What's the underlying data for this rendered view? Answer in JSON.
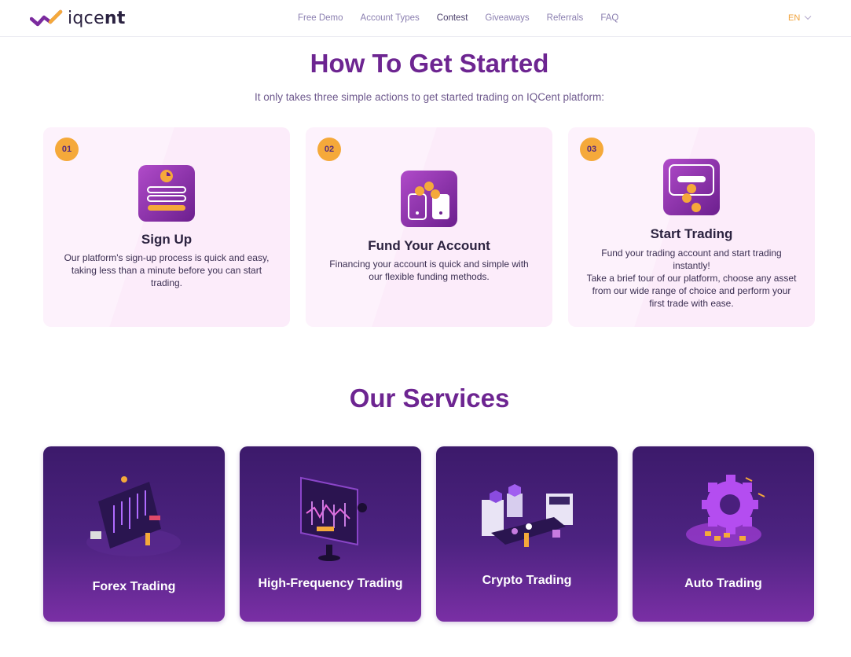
{
  "header": {
    "logo_text_light": "iqce",
    "logo_text_bold": "nt",
    "nav": [
      "Free Demo",
      "Account Types",
      "Contest",
      "Giveaways",
      "Referrals",
      "FAQ"
    ],
    "language": "EN"
  },
  "how_to": {
    "title": "How To Get Started",
    "subtitle": "It only takes three simple actions to get started trading on IQCent platform:",
    "steps": [
      {
        "number": "01",
        "icon": "signup-form-icon",
        "title": "Sign Up",
        "description": "Our platform's sign-up process is quick and easy, taking less than a minute before you can start trading."
      },
      {
        "number": "02",
        "icon": "fund-coins-icon",
        "title": "Fund Your Account",
        "description": "Financing your account is quick and simple with our flexible funding methods."
      },
      {
        "number": "03",
        "icon": "trading-card-icon",
        "title": "Start Trading",
        "description": "Fund your trading account and start trading instantly!\nTake a brief tour of our platform, choose any asset from our wide range of choice and perform your first trade with ease."
      }
    ]
  },
  "services": {
    "title": "Our Services",
    "items": [
      {
        "label": "Forex Trading",
        "icon": "forex-chart-illustration"
      },
      {
        "label": "High-Frequency Trading",
        "icon": "monitor-candles-illustration"
      },
      {
        "label": "Crypto Trading",
        "icon": "crypto-machine-illustration"
      },
      {
        "label": "Auto Trading",
        "icon": "gear-robot-illustration"
      }
    ]
  },
  "colors": {
    "brand_purple": "#6d2591",
    "accent_orange": "#f5a93a",
    "card_pink": "#fcecfa",
    "service_dark": "#3c1a6b"
  }
}
